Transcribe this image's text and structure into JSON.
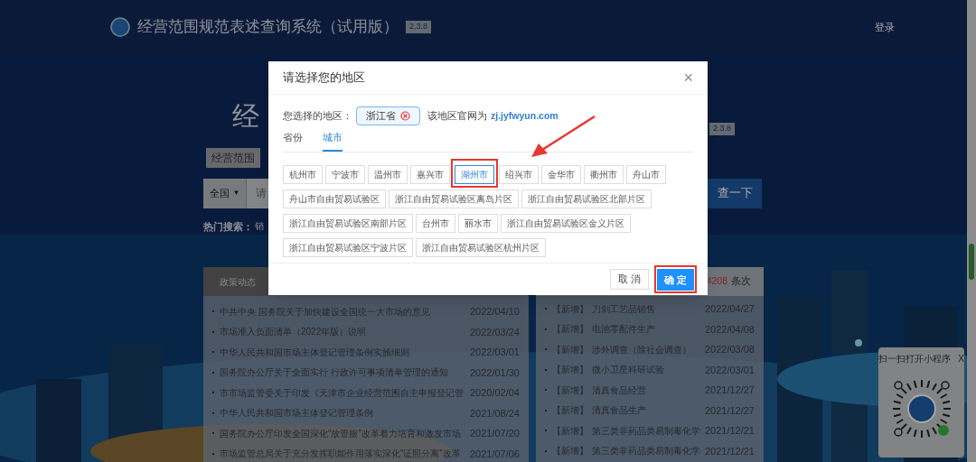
{
  "header": {
    "title": "经营范围规范表述查询系统（试用版）",
    "version": "2.3.8",
    "login": "登录"
  },
  "hero": {
    "title_visible": "经",
    "version": "2.3.8",
    "badge": "经营范围",
    "scope_select": "全国",
    "scope_caret": "▼",
    "search_placeholder_visible": "请",
    "search_button": "查一下",
    "hot_label": "热门搜索：",
    "hot_visible": "销"
  },
  "policy_panel": {
    "tab": "政策动态",
    "rows": [
      {
        "title": "中共中央 国务院关于加快建设全国统一大市场的意见",
        "date": "2022/04/10"
      },
      {
        "title": "市场准入负面清单（2022年版）说明",
        "date": "2022/03/24"
      },
      {
        "title": "中华人民共和国市场主体登记管理条例实施细则",
        "date": "2022/03/01"
      },
      {
        "title": "国务院办公厅关于全面实行 行政许可事项清单管理的通知",
        "date": "2022/01/30"
      },
      {
        "title": "市市场监管委关于印发《天津市企业经营范围自主申报登记管",
        "date": "2020/02/04"
      },
      {
        "title": "中华人民共和国市场主体登记管理条例",
        "date": "2021/08/24"
      },
      {
        "title": "国务院办公厅印发全国深化“放管服”改革着力培育和激发市场",
        "date": "2021/07/20"
      },
      {
        "title": "市场监管总局关于充分发挥职能作用落实深化“证照分离”改革",
        "date": "2021/07/06"
      }
    ]
  },
  "update_panel": {
    "count": "4208",
    "count_unit": "条次",
    "rows": [
      {
        "tag": "【新增】",
        "title": "刀剑工艺品销售",
        "date": "2022/04/27"
      },
      {
        "tag": "【新增】",
        "title": "电池零配件生产",
        "date": "2022/04/08"
      },
      {
        "tag": "【新增】",
        "title": "涉外调查（除社会调查）",
        "date": "2022/03/08"
      },
      {
        "tag": "【新增】",
        "title": "微小卫星科研试验",
        "date": "2022/03/01"
      },
      {
        "tag": "【新增】",
        "title": "清真食品经营",
        "date": "2021/12/27"
      },
      {
        "tag": "【新增】",
        "title": "清真食品生产",
        "date": "2021/12/27"
      },
      {
        "tag": "【新增】",
        "title": "第三类非药品类易制毒化学",
        "date": "2021/12/21"
      },
      {
        "tag": "【新增】",
        "title": "第三类非药品类易制毒化学",
        "date": "2021/12/21"
      }
    ]
  },
  "mini_program": {
    "label": "扫一扫打开小程序",
    "close": "X"
  },
  "dialog": {
    "title": "请选择您的地区",
    "close": "×",
    "chosen_label": "您选择的地区：",
    "chosen_region": "浙江省",
    "site_label": "该地区官网为",
    "site_link": "zj.jyfwyun.com",
    "tabs": [
      {
        "label": "省份",
        "selected": false
      },
      {
        "label": "城市",
        "selected": true
      }
    ],
    "cities": [
      {
        "label": "杭州市",
        "selected": false,
        "annotated": false
      },
      {
        "label": "宁波市",
        "selected": false,
        "annotated": false
      },
      {
        "label": "温州市",
        "selected": false,
        "annotated": false
      },
      {
        "label": "嘉兴市",
        "selected": false,
        "annotated": false
      },
      {
        "label": "湖州市",
        "selected": true,
        "annotated": true
      },
      {
        "label": "绍兴市",
        "selected": false,
        "annotated": false
      },
      {
        "label": "金华市",
        "selected": false,
        "annotated": false
      },
      {
        "label": "衢州市",
        "selected": false,
        "annotated": false
      },
      {
        "label": "舟山市",
        "selected": false,
        "annotated": false
      },
      {
        "label": "舟山市自由贸易试验区",
        "selected": false,
        "annotated": false
      },
      {
        "label": "浙江自由贸易试验区离岛片区",
        "selected": false,
        "annotated": false
      },
      {
        "label": "浙江自由贸易试验区北部片区",
        "selected": false,
        "annotated": false
      },
      {
        "label": "浙江自由贸易试验区南部片区",
        "selected": false,
        "annotated": false
      },
      {
        "label": "台州市",
        "selected": false,
        "annotated": false
      },
      {
        "label": "丽水市",
        "selected": false,
        "annotated": false
      },
      {
        "label": "浙江自由贸易试验区金义片区",
        "selected": false,
        "annotated": false
      },
      {
        "label": "浙江自由贸易试验区宁波片区",
        "selected": false,
        "annotated": false
      },
      {
        "label": "浙江自由贸易试验区杭州片区",
        "selected": false,
        "annotated": false
      }
    ],
    "cancel": "取 消",
    "confirm": {
      "label": "确 定",
      "annotated": true
    }
  }
}
